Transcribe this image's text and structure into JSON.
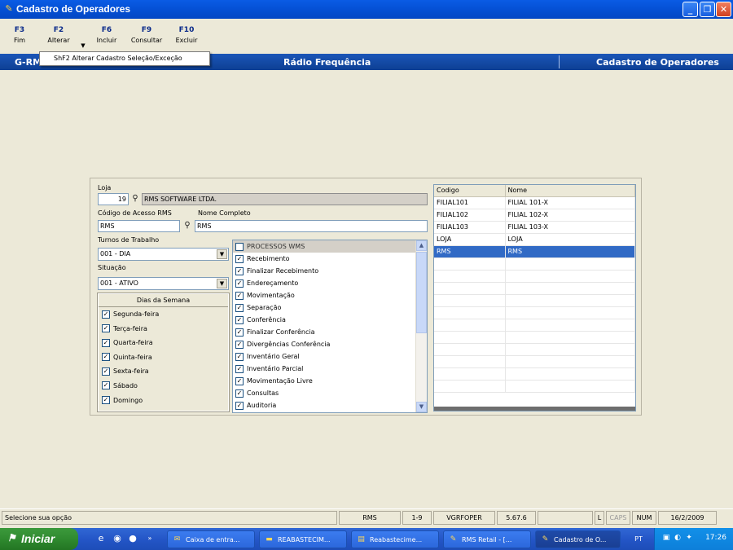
{
  "window": {
    "title": "Cadastro de Operadores"
  },
  "toolbar": [
    {
      "key": "F3",
      "label": "Fim"
    },
    {
      "key": "F2",
      "label": "Alterar"
    },
    {
      "key": "F6",
      "label": "Incluir"
    },
    {
      "key": "F9",
      "label": "Consultar"
    },
    {
      "key": "F10",
      "label": "Excluir"
    }
  ],
  "popup_menu": {
    "item": "ShF2  Alterar Cadastro Seleção/Exceção"
  },
  "band": {
    "left": "G-RM",
    "center": "Rádio Frequência",
    "right": "Cadastro de Operadores"
  },
  "form": {
    "loja_label": "Loja",
    "loja_code": "19",
    "loja_name": "RMS SOFTWARE LTDA.",
    "codigo_label": "Código de Acesso RMS",
    "codigo_value": "RMS",
    "nome_label": "Nome Completo",
    "nome_value": "RMS",
    "turnos_label": "Turnos de Trabalho",
    "turnos_value": "001 - DIA",
    "situacao_label": "Situação",
    "situacao_value": "001 - ATIVO"
  },
  "dias": {
    "header": "Dias da Semana",
    "items": [
      {
        "label": "Segunda-feira",
        "checked": true
      },
      {
        "label": "Terça-feira",
        "checked": true
      },
      {
        "label": "Quarta-feira",
        "checked": true
      },
      {
        "label": "Quinta-feira",
        "checked": true
      },
      {
        "label": "Sexta-feira",
        "checked": true
      },
      {
        "label": "Sábado",
        "checked": true
      },
      {
        "label": "Domingo",
        "checked": true
      }
    ]
  },
  "processos": {
    "header": "PROCESSOS WMS",
    "items": [
      "Recebimento",
      "Finalizar Recebimento",
      "Endereçamento",
      "Movimentação",
      "Separação",
      "Conferência",
      "Finalizar Conferência",
      "Divergências Conferência",
      "Inventário Geral",
      "Inventário Parcial",
      "Movimentação Livre",
      "Consultas",
      "Auditoria"
    ]
  },
  "grid": {
    "columns": [
      "Codigo",
      "Nome"
    ],
    "rows": [
      [
        "FILIAL101",
        "FILIAL 101-X"
      ],
      [
        "FILIAL102",
        "FILIAL 102-X"
      ],
      [
        "FILIAL103",
        "FILIAL 103-X"
      ],
      [
        "LOJA",
        "LOJA"
      ],
      [
        "RMS",
        "RMS"
      ]
    ],
    "selected_row": 4
  },
  "status": {
    "message": "Selecione sua opção",
    "user": "RMS",
    "range": "1-9",
    "program": "VGRFOPER",
    "version": "5.67.6",
    "l": "L",
    "caps": "CAPS",
    "num": "NUM",
    "date": "16/2/2009"
  },
  "taskbar": {
    "start": "Iniciar",
    "tasks": [
      "Caixa de entra...",
      "REABASTECIM...",
      "Reabastecime...",
      "RMS Retail - [...",
      "Cadastro de O..."
    ],
    "lang": "PT",
    "clock": "17:26"
  },
  "colors": {
    "titlebar": "#0551d6",
    "band": "#1b56b8",
    "selection": "#316ac5",
    "taskbar": "#2456c7",
    "start": "#2f8a2f"
  }
}
